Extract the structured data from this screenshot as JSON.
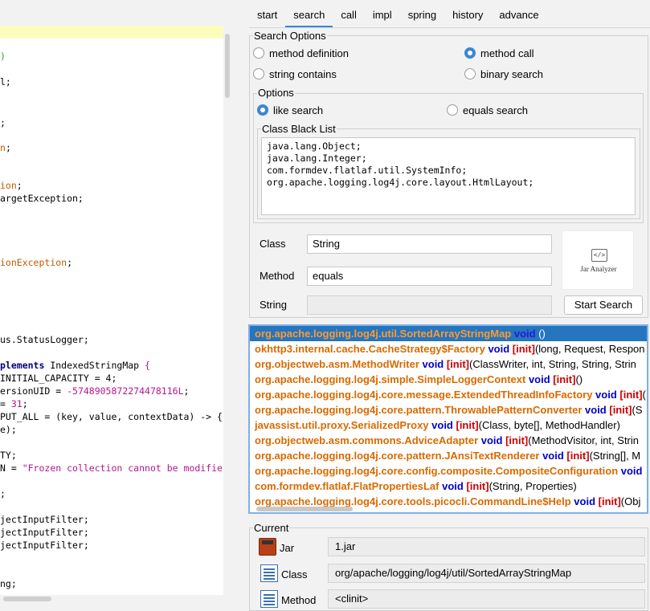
{
  "editor": {
    "lines": [
      {
        "parts": [
          {
            "t": ")",
            "k": "grn"
          }
        ]
      },
      {
        "parts": [
          {
            "t": "l;",
            "k": ""
          }
        ]
      },
      {
        "parts": [
          {
            "t": ";",
            "k": ""
          }
        ]
      },
      {
        "parts": [
          {
            "t": "n",
            "k": "cls"
          },
          {
            "t": ";",
            "k": ""
          }
        ]
      },
      {
        "parts": [
          {
            "t": "ion",
            "k": "cls"
          },
          {
            "t": ";",
            "k": ""
          }
        ]
      },
      {
        "parts": [
          {
            "t": "argetException;",
            "k": ""
          }
        ]
      },
      {
        "parts": [
          {
            "t": "ionException",
            "k": "cls"
          },
          {
            "t": ";",
            "k": ""
          }
        ]
      },
      {
        "parts": [
          {
            "t": "us.StatusLogger;",
            "k": ""
          }
        ]
      },
      {
        "parts": [
          {
            "t": "plements",
            "k": "kw"
          },
          {
            "t": " IndexedStringMap ",
            "k": ""
          },
          {
            "t": "{",
            "k": "str"
          }
        ]
      },
      {
        "parts": [
          {
            "t": "INITIAL_CAPACITY = 4;",
            "k": ""
          }
        ]
      },
      {
        "parts": [
          {
            "t": "ersionUID = ",
            "k": ""
          },
          {
            "t": "-5748905872274478116L",
            "k": "str"
          },
          {
            "t": ";",
            "k": ""
          }
        ]
      },
      {
        "parts": [
          {
            "t": "= ",
            "k": ""
          },
          {
            "t": "31",
            "k": "str"
          },
          {
            "t": ";",
            "k": ""
          }
        ]
      },
      {
        "parts": [
          {
            "t": "PUT_ALL = (key, value, contextData) -> {",
            "k": ""
          }
        ]
      },
      {
        "parts": [
          {
            "t": "e);",
            "k": ""
          }
        ]
      },
      {
        "parts": [
          {
            "t": "TY;",
            "k": ""
          }
        ]
      },
      {
        "parts": [
          {
            "t": "N = ",
            "k": ""
          },
          {
            "t": "\"Frozen collection cannot be modifie",
            "k": "str"
          }
        ]
      },
      {
        "parts": [
          {
            "t": ";",
            "k": ""
          }
        ]
      },
      {
        "parts": [
          {
            "t": "jectInputFilter;",
            "k": ""
          }
        ]
      },
      {
        "parts": [
          {
            "t": "jectInputFilter;",
            "k": ""
          }
        ]
      },
      {
        "parts": [
          {
            "t": "jectInputFilter;",
            "k": ""
          }
        ]
      },
      {
        "parts": [
          {
            "t": "ng;",
            "k": ""
          }
        ]
      }
    ]
  },
  "tabs": [
    "start",
    "search",
    "call",
    "impl",
    "spring",
    "history",
    "advance"
  ],
  "search_options": {
    "title": "Search Options",
    "method_definition": "method definition",
    "method_call": "method call",
    "string_contains": "string contains",
    "binary_search": "binary search"
  },
  "options": {
    "title": "Options",
    "like_search": "like search",
    "equals_search": "equals search"
  },
  "black_list": {
    "title": "Class Black List",
    "text": "java.lang.Object;\njava.lang.Integer;\ncom.formdev.flatlaf.util.SystemInfo;\norg.apache.logging.log4j.core.layout.HtmlLayout;"
  },
  "form": {
    "class_label": "Class",
    "class_value": "String",
    "method_label": "Method",
    "method_value": "equals",
    "string_label": "String",
    "string_value": "",
    "start_search": "Start Search"
  },
  "logo": {
    "glyph": "</>",
    "name": "Jar Analyzer"
  },
  "results": [
    {
      "cls": "org.apache.logging.log4j.util.SortedArrayStringMap",
      "ret": "void",
      "method": "",
      "args": "()"
    },
    {
      "cls": "okhttp3.internal.cache.CacheStrategy$Factory",
      "ret": "void",
      "method": "[init]",
      "args": "(long, Request, Respon"
    },
    {
      "cls": "org.objectweb.asm.MethodWriter",
      "ret": "void",
      "method": "[init]",
      "args": "(ClassWriter, int, String, String, Strin"
    },
    {
      "cls": "org.apache.logging.log4j.simple.SimpleLoggerContext",
      "ret": "void",
      "method": "[init]",
      "args": "()"
    },
    {
      "cls": "org.apache.logging.log4j.core.message.ExtendedThreadInfoFactory",
      "ret": "void",
      "method": "[init]",
      "args": "("
    },
    {
      "cls": "org.apache.logging.log4j.core.pattern.ThrowablePatternConverter",
      "ret": "void",
      "method": "[init]",
      "args": "(S"
    },
    {
      "cls": "javassist.util.proxy.SerializedProxy",
      "ret": "void",
      "method": "[init]",
      "args": "(Class, byte[], MethodHandler)"
    },
    {
      "cls": "org.objectweb.asm.commons.AdviceAdapter",
      "ret": "void",
      "method": "[init]",
      "args": "(MethodVisitor, int, Strin"
    },
    {
      "cls": "org.apache.logging.log4j.core.pattern.JAnsiTextRenderer",
      "ret": "void",
      "method": "[init]",
      "args": "(String[], M"
    },
    {
      "cls": "org.apache.logging.log4j.core.config.composite.CompositeConfiguration",
      "ret": "void",
      "method": "",
      "args": ""
    },
    {
      "cls": "com.formdev.flatlaf.FlatPropertiesLaf",
      "ret": "void",
      "method": "[init]",
      "args": "(String, Properties)"
    },
    {
      "cls": "org.apache.logging.log4j.core.tools.picocli.CommandLine$Help",
      "ret": "void",
      "method": "[init]",
      "args": "(Obj"
    }
  ],
  "current": {
    "title": "Current",
    "jar_label": "Jar",
    "jar_value": "1.jar",
    "class_label": "Class",
    "class_value": "org/apache/logging/log4j/util/SortedArrayStringMap",
    "method_label": "Method",
    "method_value": "<clinit>"
  },
  "colors": {
    "accent": "#3b87d6",
    "selection": "#2675bf",
    "class_text": "#d86a00",
    "return_text": "#0000cc",
    "method_text": "#cc0000"
  }
}
